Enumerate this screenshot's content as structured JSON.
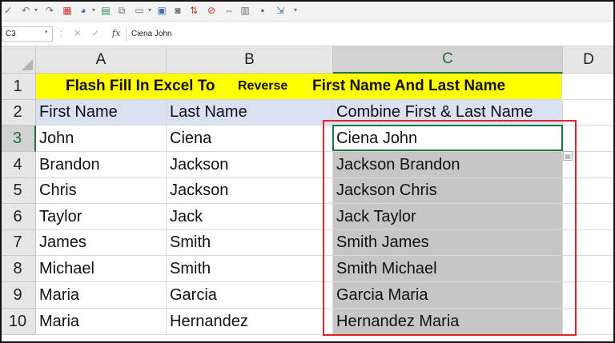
{
  "toolbar": {
    "icons": [
      "spell-check-icon",
      "undo-icon",
      "redo-icon",
      "new-sheet-icon",
      "chart-icon",
      "pie-chart-icon",
      "format-icon",
      "copy-icon",
      "paste-icon",
      "view-icon",
      "camera-icon",
      "sort-icon",
      "filter-icon",
      "center-icon",
      "save-icon",
      "export-icon",
      "more-icon"
    ]
  },
  "formula_bar": {
    "name_box": "C3",
    "cancel_symbol": "✕",
    "confirm_symbol": "✓",
    "fx_label": "fx",
    "formula": "Ciena John"
  },
  "columns": [
    "A",
    "B",
    "C",
    "D"
  ],
  "rows": [
    "1",
    "2",
    "3",
    "4",
    "5",
    "6",
    "7",
    "8",
    "9",
    "10"
  ],
  "title": {
    "part1": "Flash Fill In Excel To",
    "part2": "Reverse",
    "part3": "First Name And Last Name"
  },
  "headers": [
    "First Name",
    "Last Name",
    "Combine First & Last Name"
  ],
  "data": [
    [
      "John",
      "Ciena",
      "Ciena John"
    ],
    [
      "Brandon",
      "Jackson",
      "Jackson Brandon"
    ],
    [
      "Chris",
      "Jackson",
      "Jackson Chris"
    ],
    [
      "Taylor",
      "Jack",
      "Jack Taylor"
    ],
    [
      "James",
      "Smith",
      "Smith James"
    ],
    [
      "Michael",
      "Smith",
      "Smith Michael"
    ],
    [
      "Maria",
      "Garcia",
      "Garcia Maria"
    ],
    [
      "Maria",
      "Hernandez",
      "Hernandez Maria"
    ]
  ],
  "colors": {
    "title_fill": "#ffff00",
    "header_fill": "#d9e1f2",
    "flash_fill": "#c6c6c6",
    "selection": "#217346",
    "annotation": "#e02424"
  }
}
